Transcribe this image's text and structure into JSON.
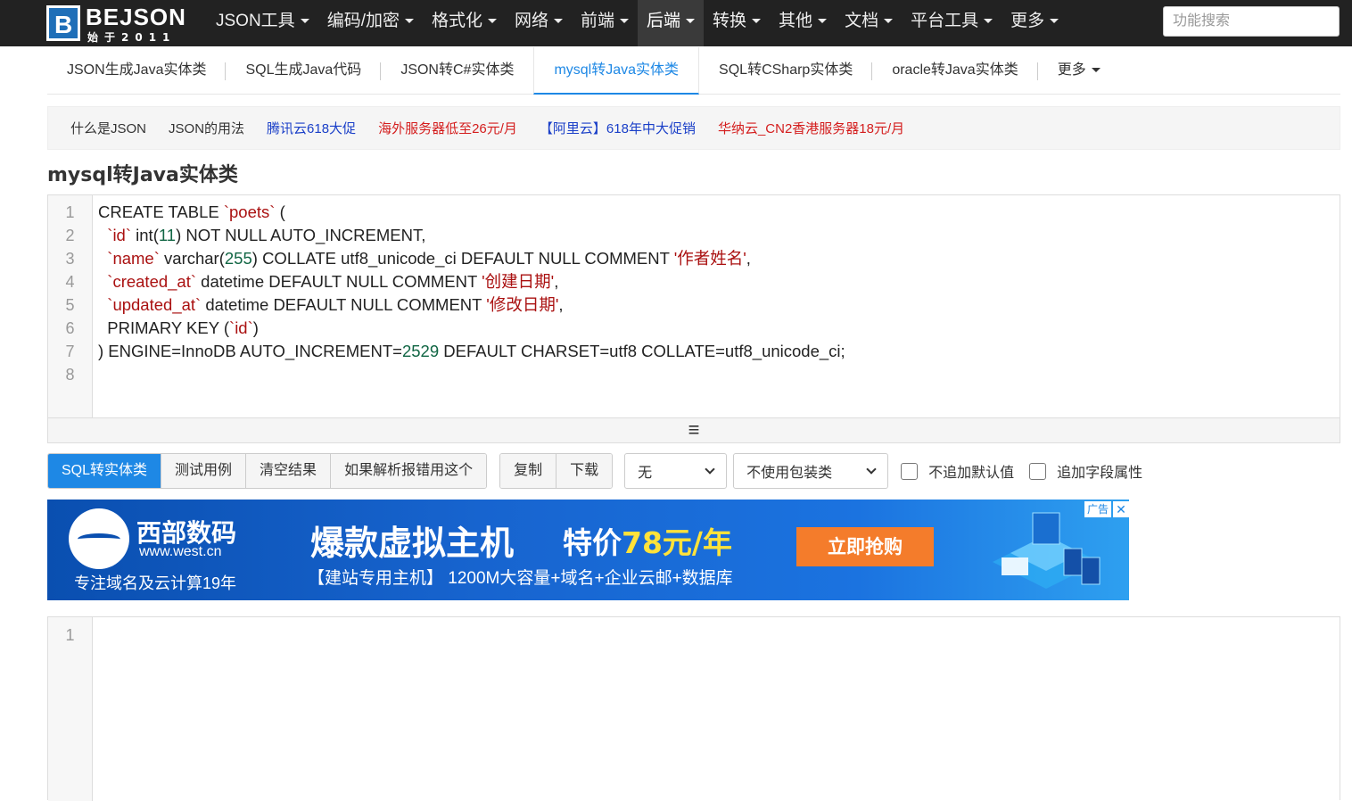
{
  "brand": {
    "name": "BEJSON",
    "sub": "始于2011",
    "mark": "B"
  },
  "nav": [
    {
      "label": "JSON工具"
    },
    {
      "label": "编码/加密"
    },
    {
      "label": "格式化"
    },
    {
      "label": "网络"
    },
    {
      "label": "前端"
    },
    {
      "label": "后端",
      "active": true
    },
    {
      "label": "转换"
    },
    {
      "label": "其他"
    },
    {
      "label": "文档"
    },
    {
      "label": "平台工具"
    },
    {
      "label": "更多"
    }
  ],
  "search": {
    "placeholder": "功能搜索"
  },
  "subtabs": [
    {
      "label": "JSON生成Java实体类"
    },
    {
      "label": "SQL生成Java代码"
    },
    {
      "label": "JSON转C#实体类"
    },
    {
      "label": "mysql转Java实体类",
      "active": true
    },
    {
      "label": "SQL转CSharp实体类"
    },
    {
      "label": "oracle转Java实体类"
    },
    {
      "label": "更多"
    }
  ],
  "links": [
    {
      "label": "什么是JSON",
      "color": "#333333"
    },
    {
      "label": "JSON的用法",
      "color": "#333333"
    },
    {
      "label": "腾讯云618大促",
      "color": "#1a3fc8"
    },
    {
      "label": "海外服务器低至26元/月",
      "color": "#d41d1d"
    },
    {
      "label": "【阿里云】618年中大促销",
      "color": "#1a3fc8"
    },
    {
      "label": "华纳云_CN2香港服务器18元/月",
      "color": "#d41d1d"
    }
  ],
  "page_title": "mysql转Java实体类",
  "editor": {
    "line_numbers": [
      "1",
      "2",
      "3",
      "4",
      "5",
      "6",
      "7",
      "8"
    ],
    "lines": [
      [
        {
          "t": "CREATE TABLE ",
          "c": "k"
        },
        {
          "t": "`poets`",
          "c": "s"
        },
        {
          "t": " (",
          "c": "k"
        }
      ],
      [
        {
          "t": "  ",
          "c": "k"
        },
        {
          "t": "`id`",
          "c": "s"
        },
        {
          "t": " int(",
          "c": "k"
        },
        {
          "t": "11",
          "c": "n"
        },
        {
          "t": ") NOT NULL AUTO_INCREMENT,",
          "c": "k"
        }
      ],
      [
        {
          "t": "  ",
          "c": "k"
        },
        {
          "t": "`name`",
          "c": "s"
        },
        {
          "t": " varchar(",
          "c": "k"
        },
        {
          "t": "255",
          "c": "n"
        },
        {
          "t": ") COLLATE utf8_unicode_ci DEFAULT NULL COMMENT ",
          "c": "k"
        },
        {
          "t": "'作者姓名'",
          "c": "s"
        },
        {
          "t": ",",
          "c": "k"
        }
      ],
      [
        {
          "t": "  ",
          "c": "k"
        },
        {
          "t": "`created_at`",
          "c": "s"
        },
        {
          "t": " datetime DEFAULT NULL COMMENT ",
          "c": "k"
        },
        {
          "t": "'创建日期'",
          "c": "s"
        },
        {
          "t": ",",
          "c": "k"
        }
      ],
      [
        {
          "t": "  ",
          "c": "k"
        },
        {
          "t": "`updated_at`",
          "c": "s"
        },
        {
          "t": " datetime DEFAULT NULL COMMENT ",
          "c": "k"
        },
        {
          "t": "'修改日期'",
          "c": "s"
        },
        {
          "t": ",",
          "c": "k"
        }
      ],
      [
        {
          "t": "  PRIMARY KEY (",
          "c": "k"
        },
        {
          "t": "`id`",
          "c": "s"
        },
        {
          "t": ")",
          "c": "k"
        }
      ],
      [
        {
          "t": ") ENGINE=InnoDB AUTO_INCREMENT=",
          "c": "k"
        },
        {
          "t": "2529",
          "c": "n"
        },
        {
          "t": " DEFAULT CHARSET=utf8 COLLATE=utf8_unicode_ci;",
          "c": "k"
        }
      ],
      []
    ],
    "handle_icon": "≡"
  },
  "toolbar": {
    "group1": [
      "SQL转实体类",
      "测试用例",
      "清空结果",
      "如果解析报错用这个"
    ],
    "group2": [
      "复制",
      "下载"
    ],
    "select1": "无",
    "select2": "不使用包装类",
    "check1": "不追加默认值",
    "check2": "追加字段属性"
  },
  "ad": {
    "brand": "西部数码",
    "url": "www.west.cn",
    "slogan": "专注域名及云计算19年",
    "headline": "爆款虚拟主机",
    "price_prefix": "特价",
    "price": "78元/年",
    "sub": "【建站专用主机】 1200M大容量+域名+企业云邮+数据库",
    "cta": "立即抢购",
    "tag": "广告",
    "close": "✕"
  },
  "output": {
    "line_numbers": [
      "1"
    ]
  },
  "colors": {
    "accent": "#1e88e5",
    "nav_bg": "#222222"
  }
}
